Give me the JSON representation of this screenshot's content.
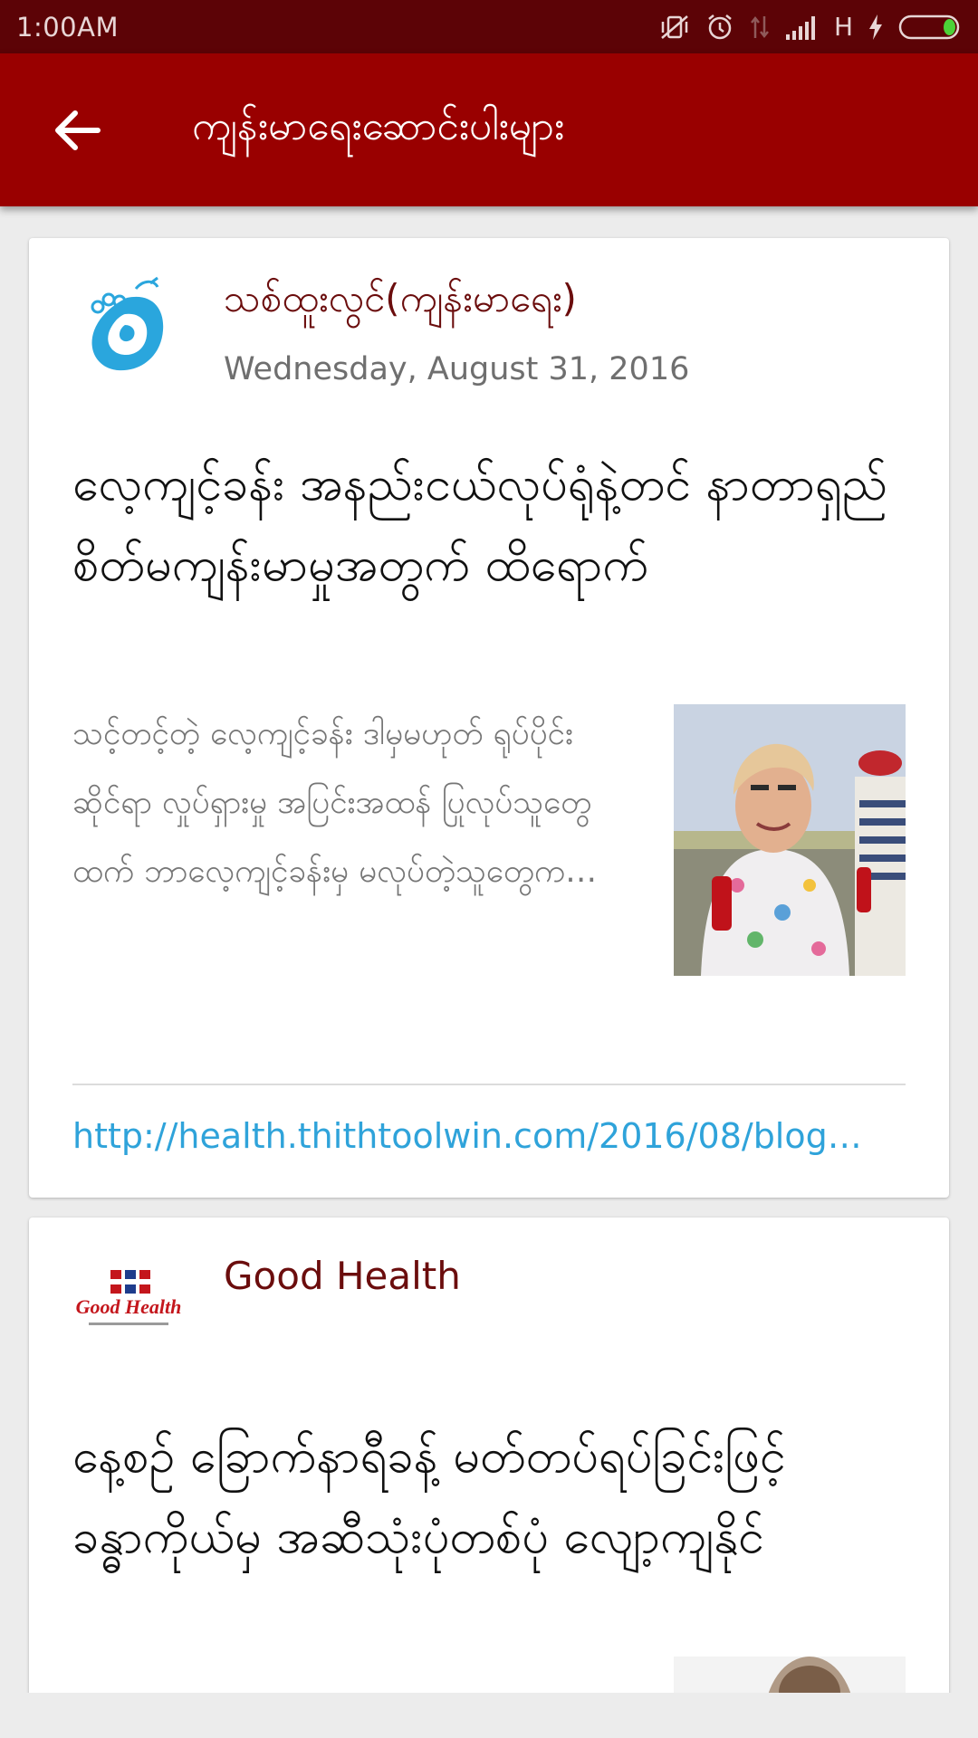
{
  "status_bar": {
    "time": "1:00AM",
    "network": "H"
  },
  "toolbar": {
    "title": "ကျန်းမာရေးဆောင်းပါးများ"
  },
  "posts": [
    {
      "source": "သစ်ထူးလွင်(ကျန်းမာရေး)",
      "date": "Wednesday, August 31, 2016",
      "title": "လေ့ကျင့်ခန်း အနည်းငယ်လုပ်ရုံနဲ့တင် နာတာရှည် စိတ်မကျန်းမာမှုအတွက် ထိရောက်",
      "excerpt": "သင့်တင့်တဲ့ လေ့ကျင့်ခန်း ဒါမှမဟုတ် ရုပ်ပိုင်းဆိုင်ရာ လှုပ်ရှားမှု အပြင်းအထန် ပြုလုပ်သူတွေထက် ဘာလေ့ကျင့်ခန်းမှ မလုပ်တဲ့သူတွေက…",
      "link": "http://health.thithtoolwin.com/2016/08/blog…"
    },
    {
      "source": "Good Health",
      "logo_text": "Good Health",
      "title": "နေ့စဉ် ခြောက်နာရီခန့် မတ်တပ်ရပ်ခြင်းဖြင့် ခန္ဓာကိုယ်မှ အဆီသုံးပုံတစ်ပုံ လျော့ကျနိုင်"
    }
  ],
  "colors": {
    "toolbar": "#990000",
    "status_bar": "#5c0306",
    "source_name": "#6b0d0d",
    "link": "#2fa3da",
    "battery": "#4cd137"
  }
}
